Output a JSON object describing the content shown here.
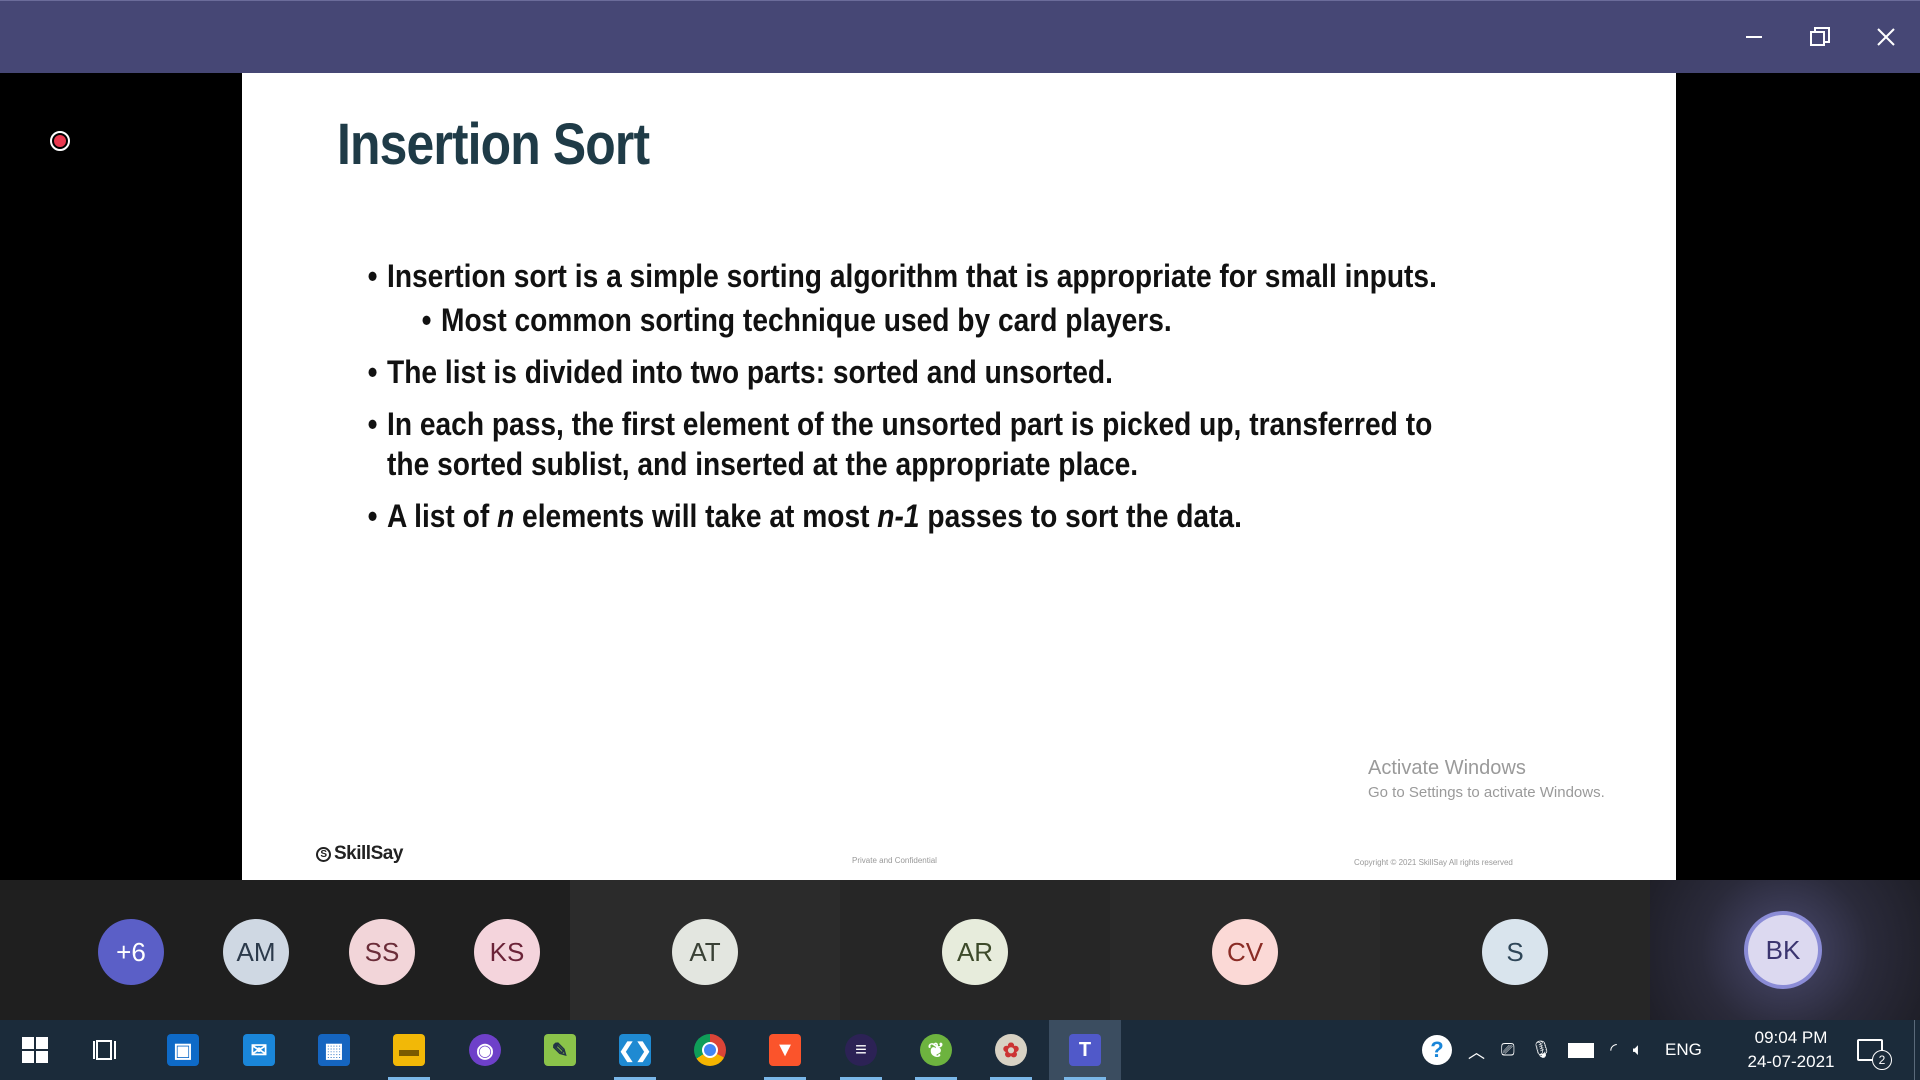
{
  "window": {
    "controls": {
      "minimize": "minimize-icon",
      "restore": "restore-icon",
      "close": "close-icon"
    }
  },
  "recording_indicator": "recording-icon",
  "slide": {
    "title": "Insertion Sort",
    "bullets": {
      "b1": "Insertion sort is a simple sorting algorithm that is appropriate for small inputs.",
      "b1_sub": "Most common sorting technique used by card players.",
      "b2": "The list is divided into two parts: sorted and unsorted.",
      "b3": "In each pass, the first element of the unsorted part is picked up, transferred to the sorted sublist, and inserted at the appropriate place.",
      "b4_pre": "A list of ",
      "b4_n": "n",
      "b4_mid": " elements will take at most ",
      "b4_n1": "n-1",
      "b4_post": " passes to sort the data."
    },
    "logo": "SkillSay",
    "footer_center": "Private and Confidential",
    "footer_right": "Copyright © 2021 SkillSay All rights reserved"
  },
  "watermark": {
    "line1": "Activate Windows",
    "line2": "Go to Settings to activate Windows."
  },
  "participants": [
    {
      "initials": "+6",
      "bg": "#5b5fc7",
      "fg": "#ffffff"
    },
    {
      "initials": "AM",
      "bg": "#cfd8e3",
      "fg": "#2c3a4b"
    },
    {
      "initials": "SS",
      "bg": "#f2d5d9",
      "fg": "#6b2d39"
    },
    {
      "initials": "KS",
      "bg": "#f4d4dc",
      "fg": "#6b2338"
    },
    {
      "initials": "AT",
      "bg": "#e3e6e0",
      "fg": "#3a4136"
    },
    {
      "initials": "AR",
      "bg": "#e7ecdc",
      "fg": "#3d4a2a"
    },
    {
      "initials": "CV",
      "bg": "#fbd9d6",
      "fg": "#8a2c25"
    },
    {
      "initials": "S",
      "bg": "#d9e4ed",
      "fg": "#2f4658"
    },
    {
      "initials": "BK",
      "bg": "#dcd9f0",
      "fg": "#3b3570"
    }
  ],
  "taskbar": {
    "apps": [
      {
        "name": "start",
        "icon": "windows-icon"
      },
      {
        "name": "task-view",
        "icon": "task-view-icon"
      },
      {
        "name": "store",
        "icon": "store-icon"
      },
      {
        "name": "mail",
        "icon": "mail-icon"
      },
      {
        "name": "calendar",
        "icon": "calendar-icon"
      },
      {
        "name": "file-explorer",
        "icon": "folder-icon"
      },
      {
        "name": "github",
        "icon": "github-icon"
      },
      {
        "name": "notepad-plus",
        "icon": "notepad-icon"
      },
      {
        "name": "vscode",
        "icon": "vscode-icon"
      },
      {
        "name": "chrome",
        "icon": "chrome-icon"
      },
      {
        "name": "brave",
        "icon": "brave-icon"
      },
      {
        "name": "eclipse",
        "icon": "eclipse-icon"
      },
      {
        "name": "spring",
        "icon": "spring-icon"
      },
      {
        "name": "paint",
        "icon": "paint-icon"
      },
      {
        "name": "teams",
        "icon": "teams-icon"
      }
    ],
    "tray": {
      "language": "ENG",
      "time": "09:04 PM",
      "date": "24-07-2021",
      "notification_count": "2"
    }
  }
}
